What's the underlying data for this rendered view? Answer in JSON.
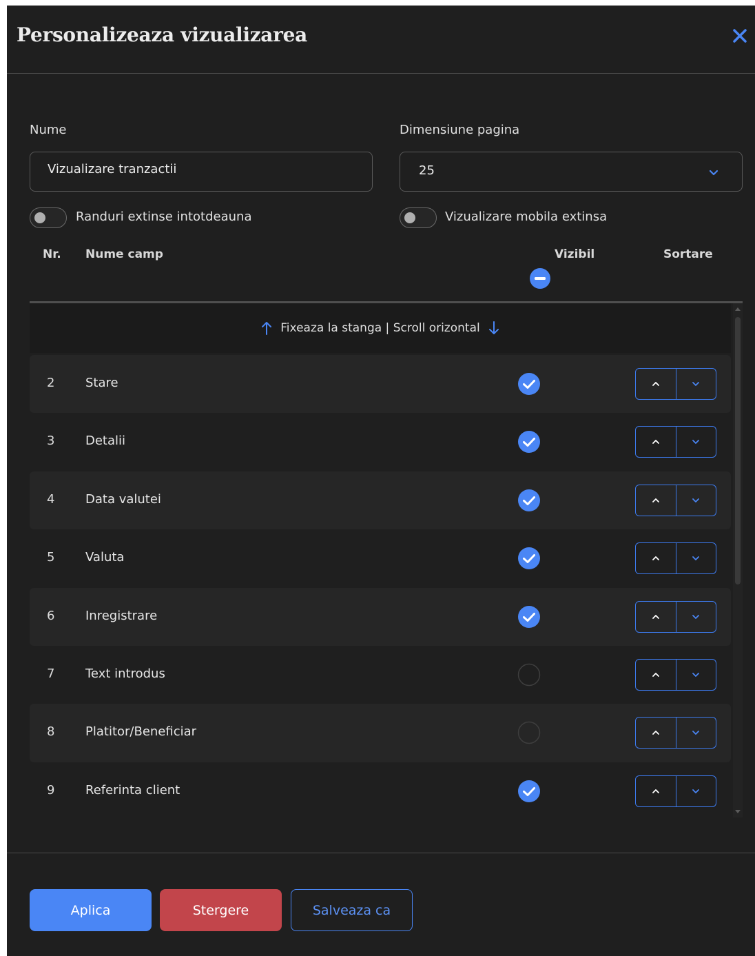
{
  "dialog": {
    "title": "Personalizeaza vizualizarea",
    "close_icon": "close-icon"
  },
  "form": {
    "name_label": "Nume",
    "name_value": "Vizualizare tranzactii",
    "page_size_label": "Dimensiune pagina",
    "page_size_value": "25",
    "toggle_expanded_rows_label": "Randuri extinse intotdeauna",
    "toggle_expanded_rows_on": false,
    "toggle_mobile_label": "Vizualizare mobila extinsa",
    "toggle_mobile_on": false
  },
  "table": {
    "headers": {
      "nr": "Nr.",
      "name": "Nume camp",
      "visible": "Vizibil",
      "sort": "Sortare"
    },
    "pin_text": "Fixeaza la stanga | Scroll orizontal",
    "rows": [
      {
        "nr": "2",
        "name": "Stare",
        "visible": true
      },
      {
        "nr": "3",
        "name": "Detalii",
        "visible": true
      },
      {
        "nr": "4",
        "name": "Data valutei",
        "visible": true
      },
      {
        "nr": "5",
        "name": "Valuta",
        "visible": true
      },
      {
        "nr": "6",
        "name": "Inregistrare",
        "visible": true
      },
      {
        "nr": "7",
        "name": "Text introdus",
        "visible": false
      },
      {
        "nr": "8",
        "name": "Platitor/Beneficiar",
        "visible": false
      },
      {
        "nr": "9",
        "name": "Referinta client",
        "visible": true
      }
    ]
  },
  "footer": {
    "apply_label": "Aplica",
    "delete_label": "Stergere",
    "save_as_label": "Salveaza ca"
  },
  "colors": {
    "accent": "#4a86f5",
    "danger": "#c2454b",
    "background": "#1f1f1f",
    "row_alt": "#262626"
  }
}
